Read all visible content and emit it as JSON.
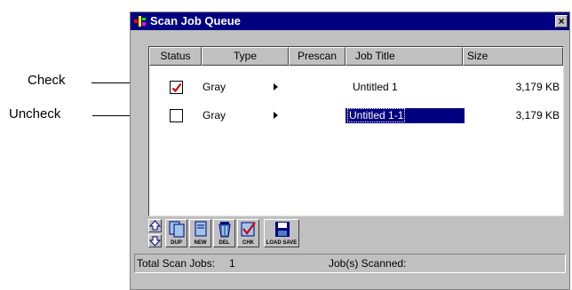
{
  "callouts": {
    "check": "Check",
    "uncheck": "Uncheck"
  },
  "window": {
    "title": "Scan Job Queue",
    "close_glyph": "×"
  },
  "columns": [
    "Status",
    "Type",
    "Prescan",
    "Job Title",
    "Size"
  ],
  "rows": [
    {
      "checked": true,
      "type": "Gray",
      "job_title": "Untitled 1",
      "size": "3,179 KB",
      "selected": false
    },
    {
      "checked": false,
      "type": "Gray",
      "job_title": "Untitled 1-1",
      "size": "3,179 KB",
      "selected": true
    }
  ],
  "toolbar": {
    "move_up_icon": "arrow-up-icon",
    "move_down_icon": "arrow-down-icon",
    "dup_label": "DUP",
    "new_label": "NEW",
    "del_label": "DEL",
    "chk_label": "CHK",
    "load_save_label": "LOAD SAVE"
  },
  "status": {
    "total_jobs_label": "Total Scan Jobs:",
    "total_jobs_value": "1",
    "scanned_label": "Job(s) Scanned:"
  },
  "colors": {
    "titlebar": "#000080",
    "face": "#c0c0c0",
    "check_mark": "#cc0000",
    "selection": "#000080"
  }
}
